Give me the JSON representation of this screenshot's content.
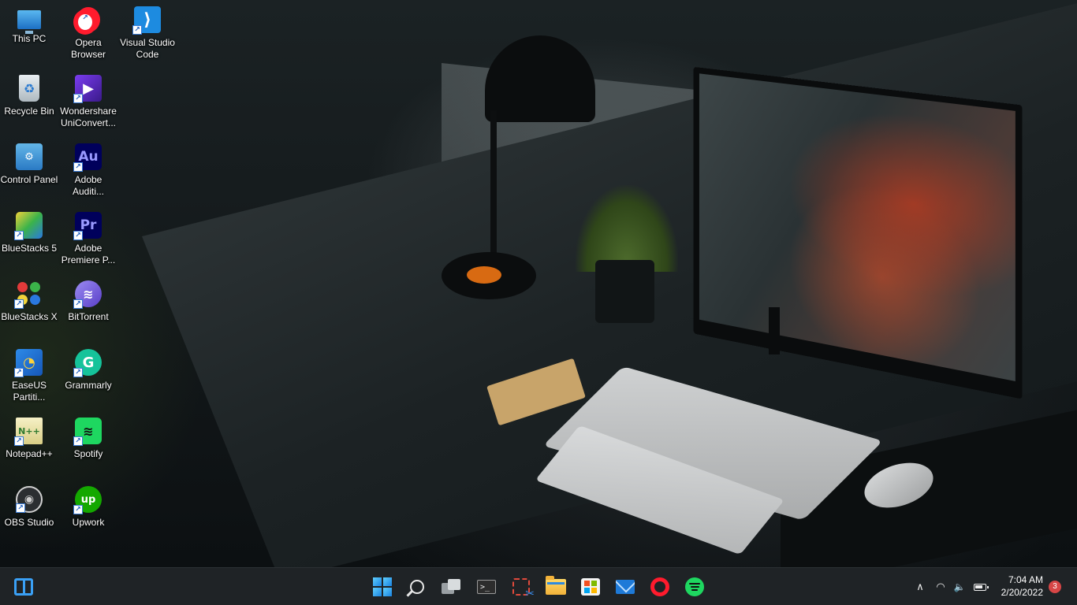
{
  "desktop": {
    "icons": [
      {
        "id": "this-pc",
        "label": "This PC"
      },
      {
        "id": "opera",
        "label": "Opera Browser"
      },
      {
        "id": "vscode",
        "label": "Visual Studio Code"
      },
      {
        "id": "recycle-bin",
        "label": "Recycle Bin"
      },
      {
        "id": "wondershare",
        "label": "Wondershare UniConvert..."
      },
      {
        "id": "control-panel",
        "label": "Control Panel"
      },
      {
        "id": "audition",
        "label": "Adobe Auditi..."
      },
      {
        "id": "bluestacks5",
        "label": "BlueStacks 5"
      },
      {
        "id": "premiere",
        "label": "Adobe Premiere P..."
      },
      {
        "id": "bluestacksx",
        "label": "BlueStacks X"
      },
      {
        "id": "bittorrent",
        "label": "BitTorrent"
      },
      {
        "id": "easeus",
        "label": "EaseUS Partiti..."
      },
      {
        "id": "grammarly",
        "label": "Grammarly"
      },
      {
        "id": "notepadpp",
        "label": "Notepad++"
      },
      {
        "id": "spotify",
        "label": "Spotify"
      },
      {
        "id": "obs",
        "label": "OBS Studio"
      },
      {
        "id": "upwork",
        "label": "Upwork"
      }
    ],
    "icon_glyphs": {
      "vscode": "⟩",
      "recycle": "♻",
      "wondershare": "▶",
      "control": "⚙",
      "audition": "Au",
      "premiere": "Pr",
      "bittorrent": "≋",
      "easeus": "◔",
      "grammarly": "G",
      "notepad": "N++",
      "spotify": "≋",
      "obs": "◉",
      "upwork": "up",
      "shortcut": "↗"
    }
  },
  "taskbar": {
    "apps": [
      {
        "id": "widgets",
        "icon": "widgets-icon"
      },
      {
        "id": "start",
        "icon": "windows-start-icon"
      },
      {
        "id": "search",
        "icon": "search-icon"
      },
      {
        "id": "task-view",
        "icon": "task-view-icon"
      },
      {
        "id": "terminal",
        "icon": "terminal-icon"
      },
      {
        "id": "snipping-tool",
        "icon": "snipping-tool-icon"
      },
      {
        "id": "file-explorer",
        "icon": "folder-icon"
      },
      {
        "id": "microsoft-store",
        "icon": "store-icon"
      },
      {
        "id": "mail",
        "icon": "mail-icon"
      },
      {
        "id": "opera",
        "icon": "opera-icon"
      },
      {
        "id": "spotify",
        "icon": "spotify-icon"
      }
    ],
    "terminal_prompt": ">_",
    "tray": {
      "chevron": "∧",
      "wifi": "◠",
      "volume": "🔈",
      "battery": "battery-icon"
    },
    "clock": {
      "time": "7:04 AM",
      "date": "2/20/2022"
    },
    "notification_count": "3"
  },
  "colors": {
    "taskbar_bg": "#1f2326",
    "accent_blue": "#3aa0f5",
    "opera_red": "#ff1b2d",
    "spotify_green": "#1ed760",
    "badge_red": "#d74646"
  }
}
